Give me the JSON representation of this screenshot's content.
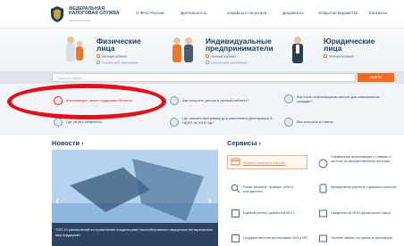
{
  "header": {
    "logo_line1": "ФЕДЕРАЛЬНАЯ",
    "logo_line2": "НАЛОГОВАЯ СЛУЖБА",
    "logo_sub": "официальный сайт",
    "nav": [
      "О ФНС России",
      "Деятельность",
      "Сервисы и госуслуги",
      "Документы",
      "Открытое ведомство",
      "Контакты"
    ]
  },
  "hero": [
    {
      "title": [
        "Физические",
        "лица"
      ],
      "cabinet": "Личный кабинет",
      "cabinet2": "Скачать моб. приложение"
    },
    {
      "title": [
        "Индивидуальные",
        "предприниматели"
      ],
      "cabinet": "Личный кабинет",
      "cabinet2": "Скачать моб. приложение"
    },
    {
      "title": [
        "Юридические",
        "лица"
      ],
      "cabinet": "Личный кабинет",
      "cabinet2": ""
    }
  ],
  "search": {
    "placeholder": "Поиск по сайту",
    "button": "Найти"
  },
  "quick_links": [
    "Коронавирус: меры поддержки бизнеса",
    "Как получить доступ в личный кабинет?",
    "Как стать плательщиком налога для самозанятых граждан?",
    "Где узнать реквизиты",
    "Где скачать программу для заполнения декларации 3-НДФЛ за 2019 год?",
    "Все вопросы и ответы"
  ],
  "news": {
    "title": "Новости ›",
    "caption": "ТОП-10 разъяснений по применению владельцами налогоблагаемого имущества антикризисных мер поддержки"
  },
  "services": {
    "title": "Сервисы ›",
    "items": [
      "Оплата налогов и пошлин",
      "Справочная информация о ставках и льготах по имущественным налогам",
      "Риски бизнеса: проверь себя и контрагента",
      "Калькулятор расчета страховых взносов",
      "Единый реестр субъектов МСП",
      "Сведения об ИНН физического лица",
      "Государственная регистрация ЮЛ и ИП",
      "Онлайн запись на прием в инспекцию"
    ]
  },
  "colors": {
    "accent": "#f36c21",
    "brand": "#1d3b5c",
    "annotation": "#e20f18"
  }
}
